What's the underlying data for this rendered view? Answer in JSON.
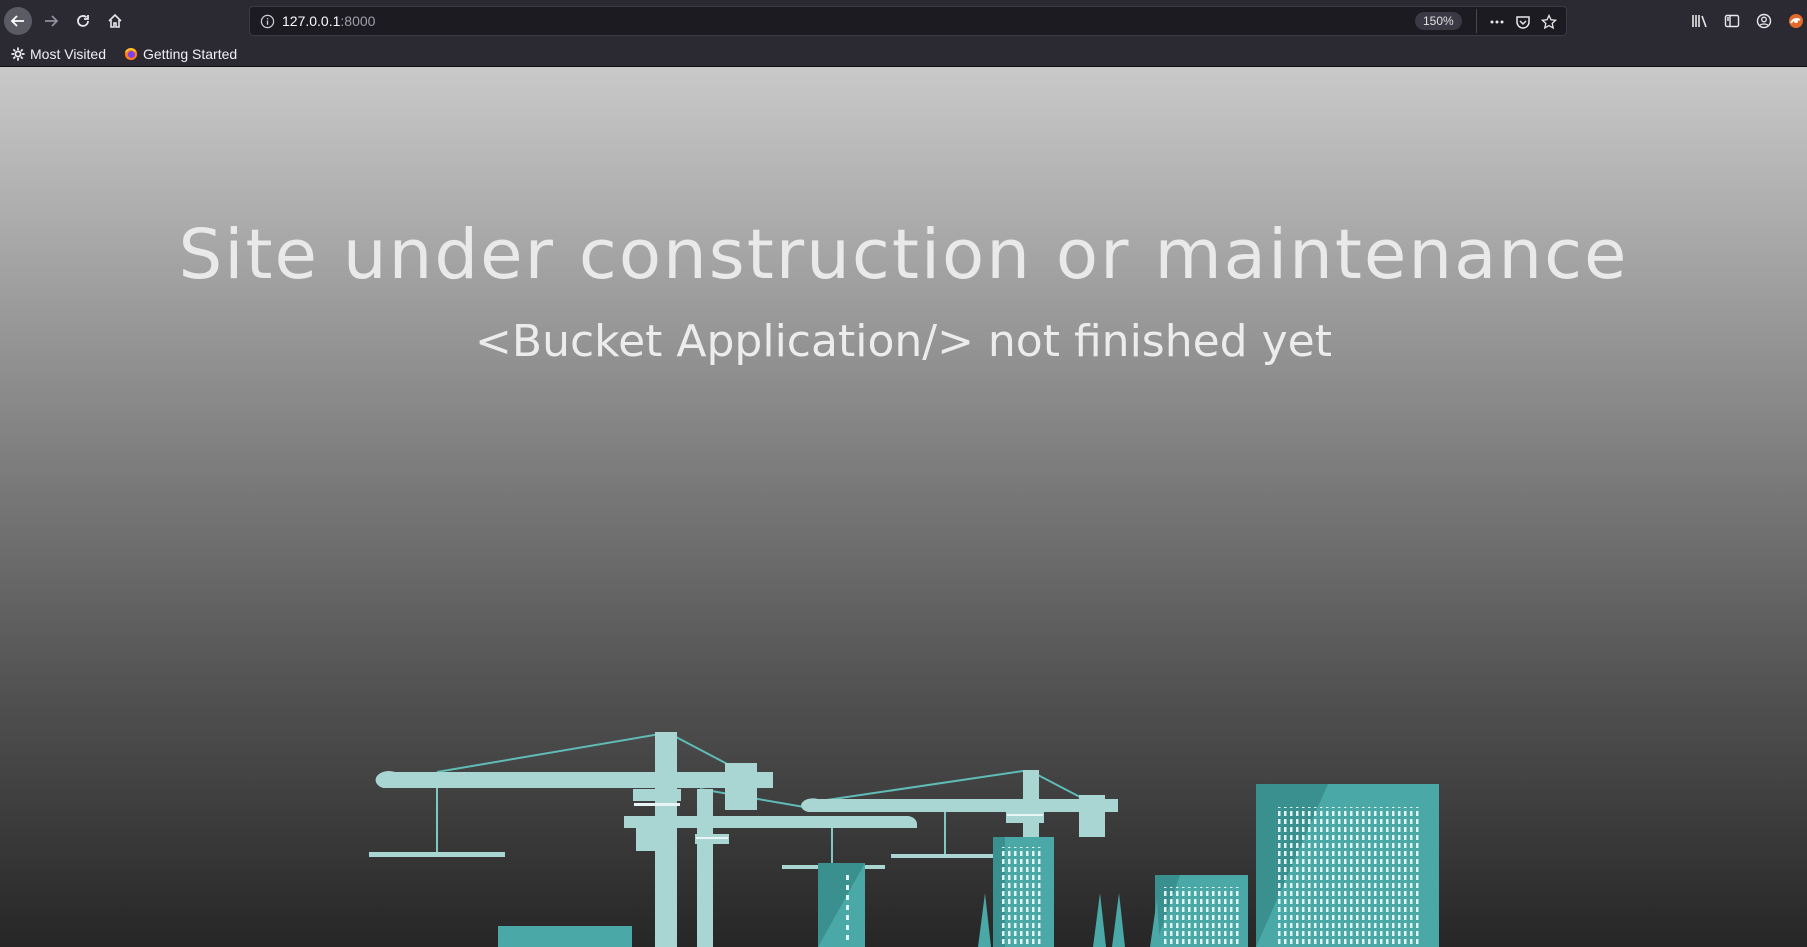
{
  "browser": {
    "url_host": "127.0.0.1",
    "url_port": ":8000",
    "zoom": "150%",
    "icons": [
      "back-icon",
      "forward-icon",
      "reload-icon",
      "home-icon",
      "info-icon",
      "more-icon",
      "pocket-icon",
      "star-icon",
      "library-icon",
      "sidebar-icon",
      "account-icon",
      "extension-icon"
    ]
  },
  "bookmarks": [
    {
      "label": "Most Visited",
      "icon": "gear-icon"
    },
    {
      "label": "Getting Started",
      "icon": "firefox-icon"
    }
  ],
  "page": {
    "headline": "Site under construction or maintenance",
    "subhead": "<Bucket Application/> not finished yet",
    "colors": {
      "gradient_top": "#c9c9c9",
      "gradient_bottom": "#262626",
      "text": "#e9e9e9",
      "crane": "#a9d6d3",
      "building": "#4aa8a6",
      "building_dark": "#3a908e"
    }
  }
}
